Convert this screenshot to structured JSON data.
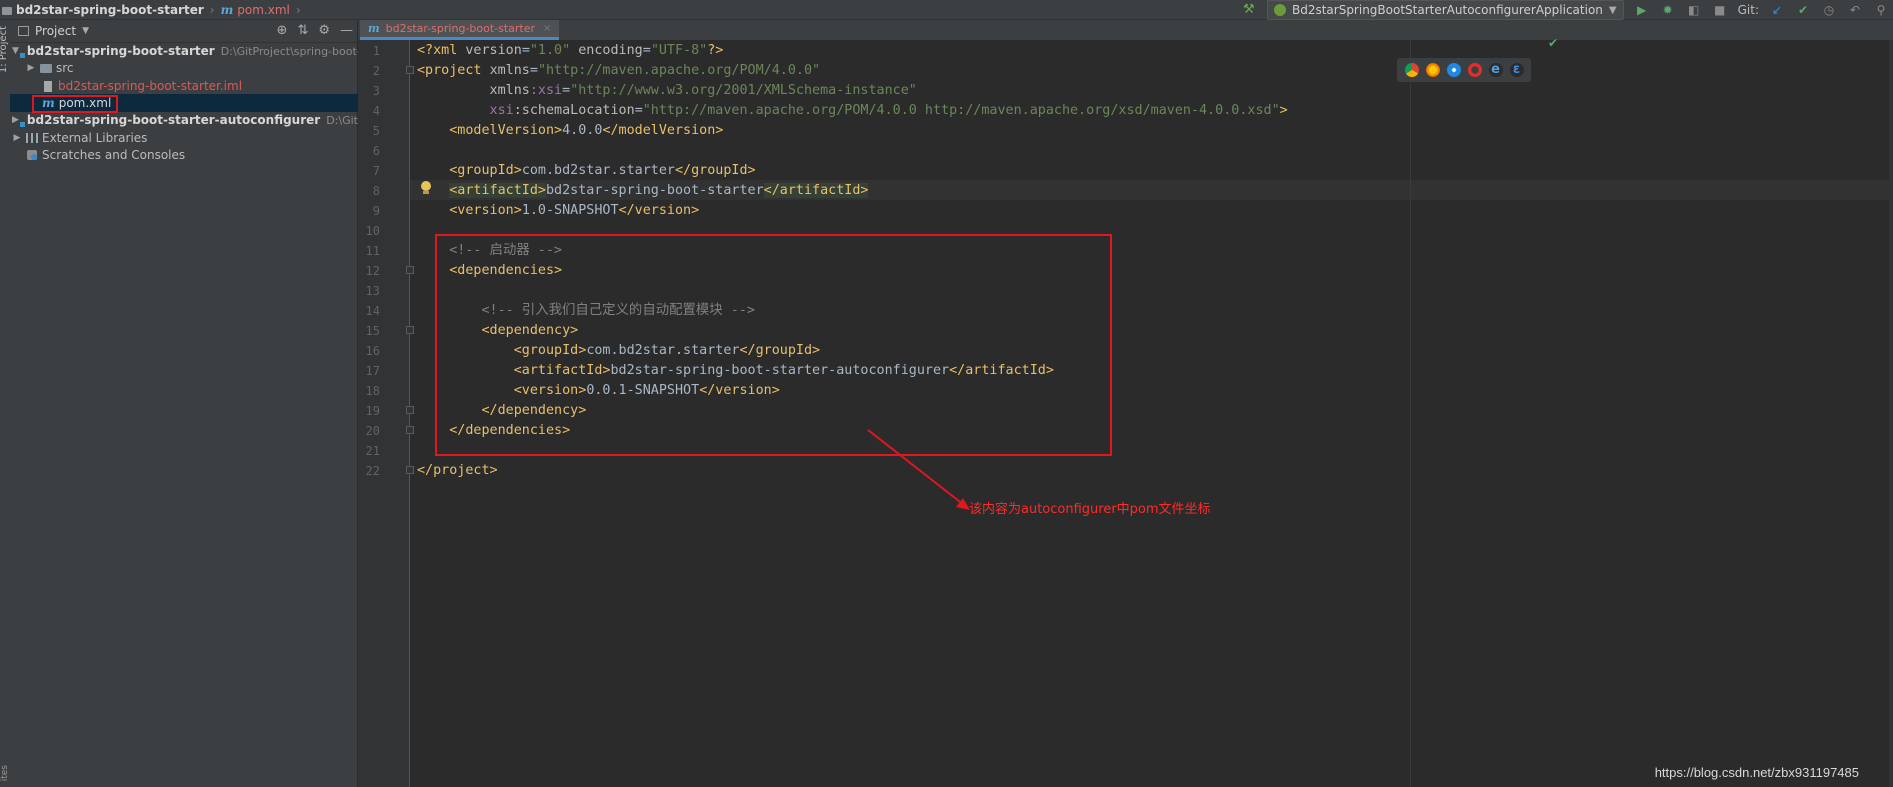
{
  "navbar": {
    "project": "bd2star-spring-boot-starter",
    "file_prefix": "m",
    "file": "pom.xml",
    "run_config": "Bd2starSpringBootStarterAutoconfigurerApplication",
    "git_label": "Git:"
  },
  "left_strip": {
    "project_tab": "1: Project",
    "bottom_tab": "ites"
  },
  "project_panel": {
    "title": "Project",
    "tree": [
      {
        "label": "bd2star-spring-boot-starter",
        "path": "D:\\GitProject\\spring-boot-demo\\bd"
      },
      {
        "label": "src"
      },
      {
        "label": "bd2star-spring-boot-starter.iml"
      },
      {
        "prefix": "m",
        "label": "pom.xml"
      },
      {
        "label": "bd2star-spring-boot-starter-autoconfigurer",
        "path": "D:\\GitProject\\sprin"
      },
      {
        "label": "External Libraries"
      },
      {
        "label": "Scratches and Consoles"
      }
    ]
  },
  "editor": {
    "tab": {
      "prefix": "m",
      "label": "bd2star-spring-boot-starter",
      "close": "×"
    },
    "line_numbers": [
      "1",
      "2",
      "3",
      "4",
      "5",
      "6",
      "7",
      "8",
      "9",
      "10",
      "11",
      "12",
      "13",
      "14",
      "15",
      "16",
      "17",
      "18",
      "19",
      "20",
      "21",
      "22"
    ],
    "lines": {
      "l1": {
        "a": "<?",
        "b": "xml ",
        "c": "version",
        "d": "=",
        "e": "\"1.0\"",
        "f": " encoding",
        "g": "=",
        "h": "\"UTF-8\"",
        "i": "?>"
      },
      "l2": {
        "a": "<project ",
        "b": "xmlns",
        "c": "=",
        "d": "\"http://maven.apache.org/POM/4.0.0\""
      },
      "l3": {
        "a": "         xmlns",
        "b": ":xsi",
        "c": "=",
        "d": "\"http://www.w3.org/2001/XMLSchema-instance\""
      },
      "l4": {
        "a": "         xsi",
        "b": ":schemaLocation",
        "c": "=",
        "d": "\"http://maven.apache.org/POM/4.0.0 http://maven.apache.org/xsd/maven-4.0.0.xsd\"",
        "e": ">"
      },
      "l5": {
        "a": "    <modelVersion>",
        "b": "4.0.0",
        "c": "</modelVersion>"
      },
      "l7": {
        "a": "    <groupId>",
        "b": "com.bd2star.starter",
        "c": "</groupId>"
      },
      "l8": {
        "a": "    ",
        "b": "<artifactId>",
        "c": "bd2star-spring-boot-starter",
        "d": "</artifactId>"
      },
      "l9": {
        "a": "    <version>",
        "b": "1.0-SNAPSHOT",
        "c": "</version>"
      },
      "l11": {
        "a": "    <!-- 启动器 -->"
      },
      "l12": {
        "a": "    <dependencies>"
      },
      "l14": {
        "a": "        <!-- 引入我们自己定义的自动配置模块 -->"
      },
      "l15": {
        "a": "        <dependency>"
      },
      "l16": {
        "a": "            <groupId>",
        "b": "com.bd2star.starter",
        "c": "</groupId>"
      },
      "l17": {
        "a": "            <artifactId>",
        "b": "bd2star-spring-boot-starter-autoconfigurer",
        "c": "</artifactId>"
      },
      "l18": {
        "a": "            <version>",
        "b": "0.0.1-SNAPSHOT",
        "c": "</version>"
      },
      "l19": {
        "a": "        </dependency>"
      },
      "l20": {
        "a": "    </dependencies>"
      },
      "l22": {
        "a": "</project>"
      }
    }
  },
  "annotation": "该内容为autoconfigurer中pom文件坐标",
  "watermark": "https://blog.csdn.net/zbx931197485",
  "colors": {
    "highlight_box": "#e0171f",
    "annotation_text": "#ff2a2a",
    "tag": "#e8bf6a",
    "string": "#6a8759",
    "comment": "#808080"
  }
}
